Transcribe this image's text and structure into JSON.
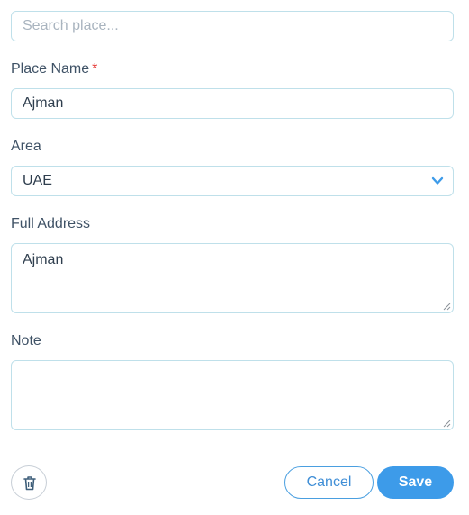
{
  "search": {
    "placeholder": "Search place..."
  },
  "place_name": {
    "label": "Place Name",
    "required_mark": "*",
    "value": "Ajman"
  },
  "area": {
    "label": "Area",
    "value": "UAE"
  },
  "full_address": {
    "label": "Full Address",
    "value": "Ajman"
  },
  "note": {
    "label": "Note",
    "value": ""
  },
  "actions": {
    "cancel_label": "Cancel",
    "save_label": "Save"
  },
  "icons": {
    "delete": "trash-icon",
    "dropdown": "chevron-down-icon"
  },
  "colors": {
    "accent": "#3d9be9",
    "required": "#e53935",
    "border": "#bfe0ea"
  }
}
